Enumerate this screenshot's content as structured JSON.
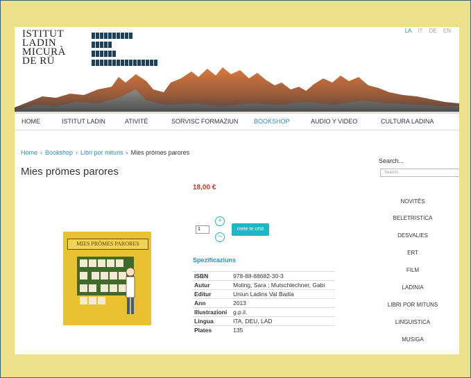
{
  "logo": {
    "lines": [
      "ISTITUT",
      "LADIN",
      "MICURÀ",
      "DE RÜ"
    ]
  },
  "languages": [
    "LA",
    "IT",
    "DE",
    "EN"
  ],
  "nav": [
    "HOME",
    "ISTITUT LADIN",
    "ATIVITÉ",
    "SORVISC FORMAZIUN",
    "BOOKSHOP",
    "AUDIO Y VIDEO",
    "CULTURA LADINA"
  ],
  "breadcrumb": [
    "Home",
    "Bookshop",
    "Libri por mituns",
    "Mies prömes parores"
  ],
  "product": {
    "title": "Mies prömes parores",
    "price": "18,00 €",
    "quantity": "1",
    "cart_label": "mete te cëst",
    "cover_title": "MIES PRÖMES PARORES",
    "spec_heading": "Spezificaziuns",
    "specs": [
      {
        "key": "ISBN",
        "value": "978-88-88682-30-3"
      },
      {
        "key": "Autur",
        "value": "Moling, Sara ; Mutschlechner, Gabi"
      },
      {
        "key": "Editur",
        "value": "Uniun Ladins Val Badia"
      },
      {
        "key": "Ann",
        "value": "2013"
      },
      {
        "key": "Illustrazioni",
        "value": "g.p.il."
      },
      {
        "key": "Lingua",
        "value": "ITA, DEU, LAD"
      },
      {
        "key": "Plates",
        "value": "135"
      }
    ]
  },
  "sidebar": {
    "search_label": "Search...",
    "search_placeholder": "Search...",
    "categories": [
      "NOVITÊS",
      "BELETRISTICA",
      "DESVALIES",
      "ERT",
      "FILM",
      "LADINIA",
      "LIBRI POR MITUNS",
      "LINGUISTICA",
      "MUSIGA"
    ]
  }
}
